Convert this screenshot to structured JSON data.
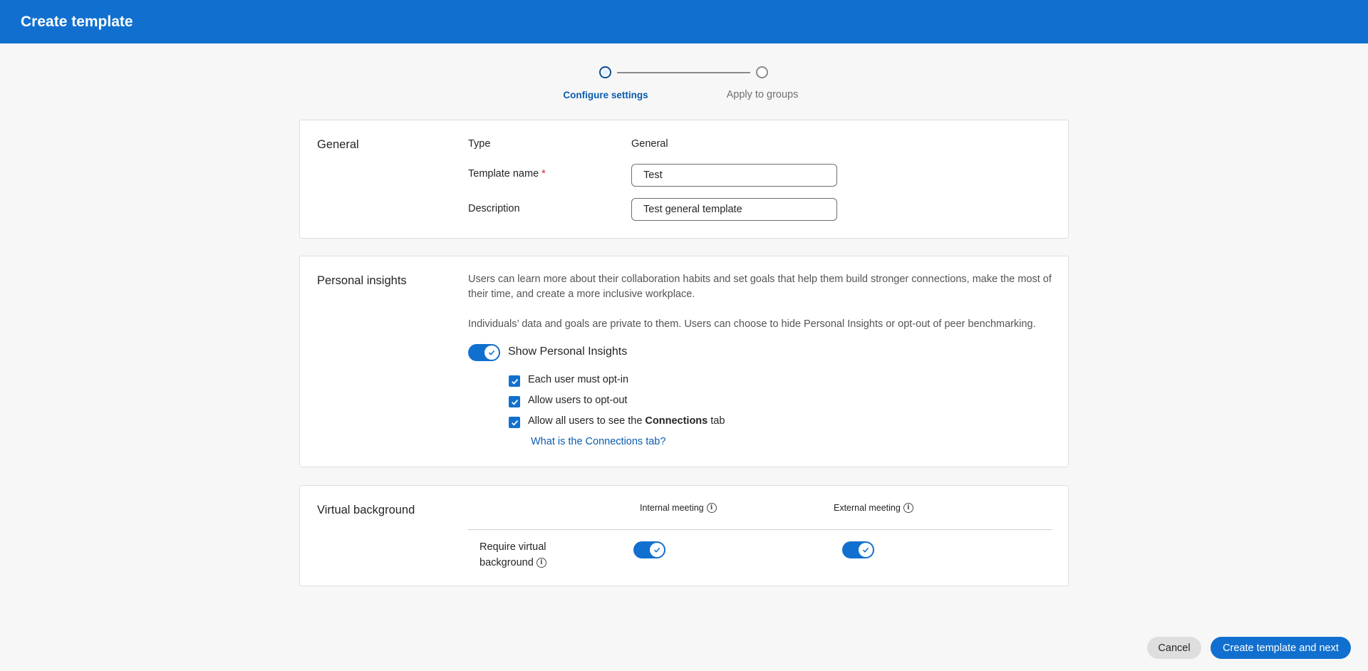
{
  "header": {
    "title": "Create template"
  },
  "stepper": {
    "steps": [
      {
        "label": "Configure settings",
        "state": "active"
      },
      {
        "label": "Apply to groups",
        "state": "inactive"
      }
    ]
  },
  "general": {
    "section_title": "General",
    "type_label": "Type",
    "type_value": "General",
    "name_label": "Template name",
    "required_mark": "*",
    "name_value": "Test",
    "description_label": "Description",
    "description_value": "Test general template"
  },
  "personal_insights": {
    "section_title": "Personal insights",
    "description_1": "Users can learn more about their collaboration habits and set goals that help them build stronger connections, make the most of their time, and create a more inclusive workplace.",
    "description_2": "Individuals’ data and goals are private to them. Users can choose to hide Personal Insights or opt-out of peer benchmarking.",
    "toggle_label": "Show Personal Insights",
    "toggle_on": true,
    "options": [
      {
        "label": "Each user must opt-in",
        "checked": true
      },
      {
        "label": "Allow users to opt-out",
        "checked": true
      },
      {
        "label_prefix": "Allow all users to see the ",
        "label_bold": "Connections",
        "label_suffix": " tab",
        "checked": true
      }
    ],
    "help_link": "What is the Connections tab?"
  },
  "virtual_background": {
    "section_title": "Virtual background",
    "col_internal": "Internal meeting",
    "col_external": "External meeting",
    "row_label_line1": "Require virtual",
    "row_label_line2": "background",
    "internal_on": true,
    "external_on": true
  },
  "footer": {
    "cancel_label": "Cancel",
    "primary_label": "Create template and next"
  },
  "colors": {
    "brand": "#1170cf",
    "link": "#0b5cad",
    "required": "#d4242e"
  },
  "icons": {
    "check": "check-icon",
    "info": "info-icon"
  }
}
